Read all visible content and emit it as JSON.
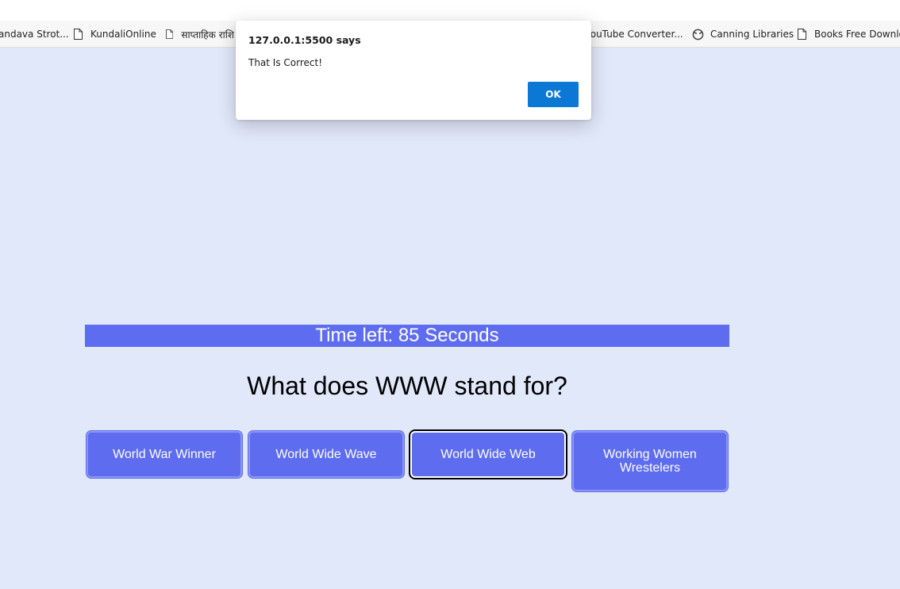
{
  "bookmarks": [
    {
      "label": "andava Strot...",
      "icon": "none"
    },
    {
      "label": "KundaliOnline",
      "icon": "page-icon"
    },
    {
      "label": "साप्ताहिक राशि",
      "icon": "page-icon"
    },
    {
      "label": "YouTube Converter...",
      "icon": "none"
    },
    {
      "label": "Canning Libraries",
      "icon": "globe-icon"
    },
    {
      "label": "Books Free Downlo...",
      "icon": "page-icon"
    }
  ],
  "alert": {
    "title": "127.0.0.1:5500 says",
    "message": "That Is Correct!",
    "ok_label": "OK",
    "ok_color": "#0a78d4"
  },
  "quiz": {
    "timer_text": "Time left: 85 Seconds",
    "question": "What does WWW stand for?",
    "answers": [
      {
        "label": "World War Winner"
      },
      {
        "label": "World Wide Wave"
      },
      {
        "label": "World Wide Web",
        "state": "selected"
      },
      {
        "label": "Working Women Wrestelers"
      }
    ],
    "accent_color": "#5e6cef",
    "background_color": "#e1e8fa"
  }
}
